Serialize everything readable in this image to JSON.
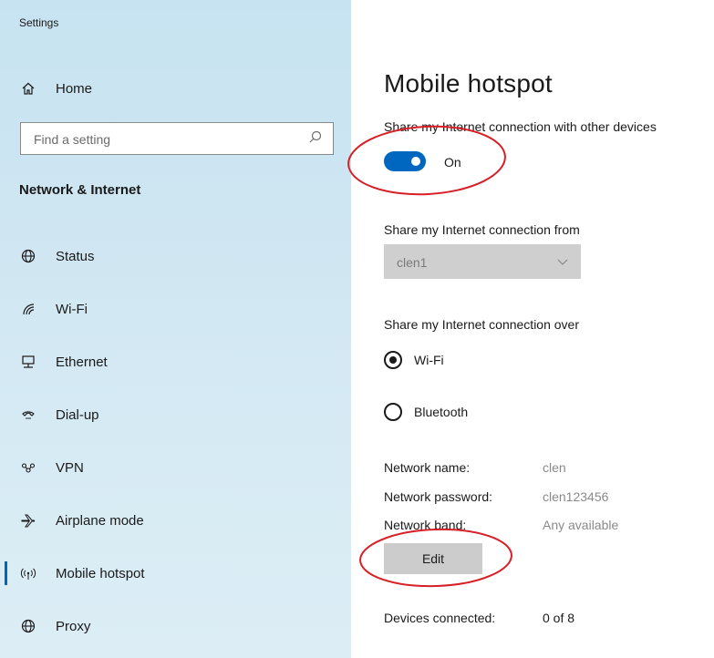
{
  "app_title": "Settings",
  "sidebar": {
    "home_label": "Home",
    "search_placeholder": "Find a setting",
    "section_title": "Network & Internet",
    "items": [
      {
        "label": "Status",
        "icon": "globe-icon"
      },
      {
        "label": "Wi-Fi",
        "icon": "wifi-icon"
      },
      {
        "label": "Ethernet",
        "icon": "ethernet-icon"
      },
      {
        "label": "Dial-up",
        "icon": "dialup-icon"
      },
      {
        "label": "VPN",
        "icon": "vpn-icon"
      },
      {
        "label": "Airplane mode",
        "icon": "airplane-icon"
      },
      {
        "label": "Mobile hotspot",
        "icon": "hotspot-icon",
        "active": true
      },
      {
        "label": "Proxy",
        "icon": "proxy-icon"
      }
    ]
  },
  "main": {
    "title": "Mobile hotspot",
    "share_label": "Share my Internet connection with other devices",
    "toggle_state": "On",
    "from_label": "Share my Internet connection from",
    "from_value": "clen1",
    "over_label": "Share my Internet connection over",
    "over_options": [
      {
        "label": "Wi-Fi",
        "selected": true
      },
      {
        "label": "Bluetooth",
        "selected": false
      }
    ],
    "network_name_label": "Network name:",
    "network_name_value": "clen",
    "network_password_label": "Network password:",
    "network_password_value": "clen123456",
    "network_band_label": "Network band:",
    "network_band_value": "Any available",
    "edit_label": "Edit",
    "devices_label": "Devices connected:",
    "devices_value": "0 of 8"
  },
  "colors": {
    "accent": "#0067c0",
    "annotation": "#d61f26",
    "sidebar_bg": "#cfe6f2"
  }
}
